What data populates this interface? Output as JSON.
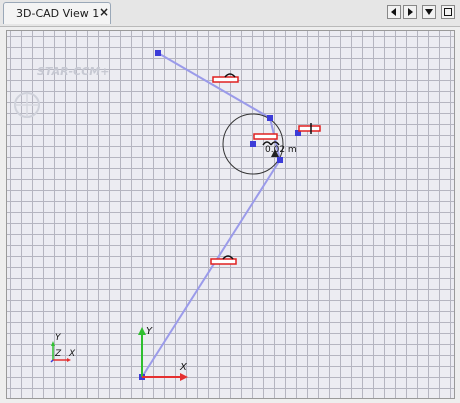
{
  "tab": {
    "title": "3D-CAD View 1",
    "close_glyph": "×"
  },
  "window_buttons": [
    {
      "name": "prev-view-button",
      "glyph": "◀",
      "icon": "arrow-left-icon"
    },
    {
      "name": "next-view-button",
      "glyph": "▶",
      "icon": "arrow-right-icon"
    },
    {
      "name": "view-menu-button",
      "glyph": "▼",
      "icon": "chevron-down-icon"
    },
    {
      "name": "maximize-button",
      "glyph": "□",
      "icon": "maximize-icon"
    }
  ],
  "logo": {
    "text": "STAR-CCM+"
  },
  "sketch": {
    "dimension_label": "0.02 m",
    "colors": {
      "line": "#9b9bea",
      "point": "#3c3cd8",
      "constraint": "#e02020",
      "axis_x": "#e53030",
      "axis_y": "#2fbf2f"
    }
  },
  "triad_large": {
    "x_label": "X",
    "y_label": "Y"
  },
  "triad_small": {
    "x_label": "X",
    "y_label": "Y",
    "z_label": "Z"
  }
}
